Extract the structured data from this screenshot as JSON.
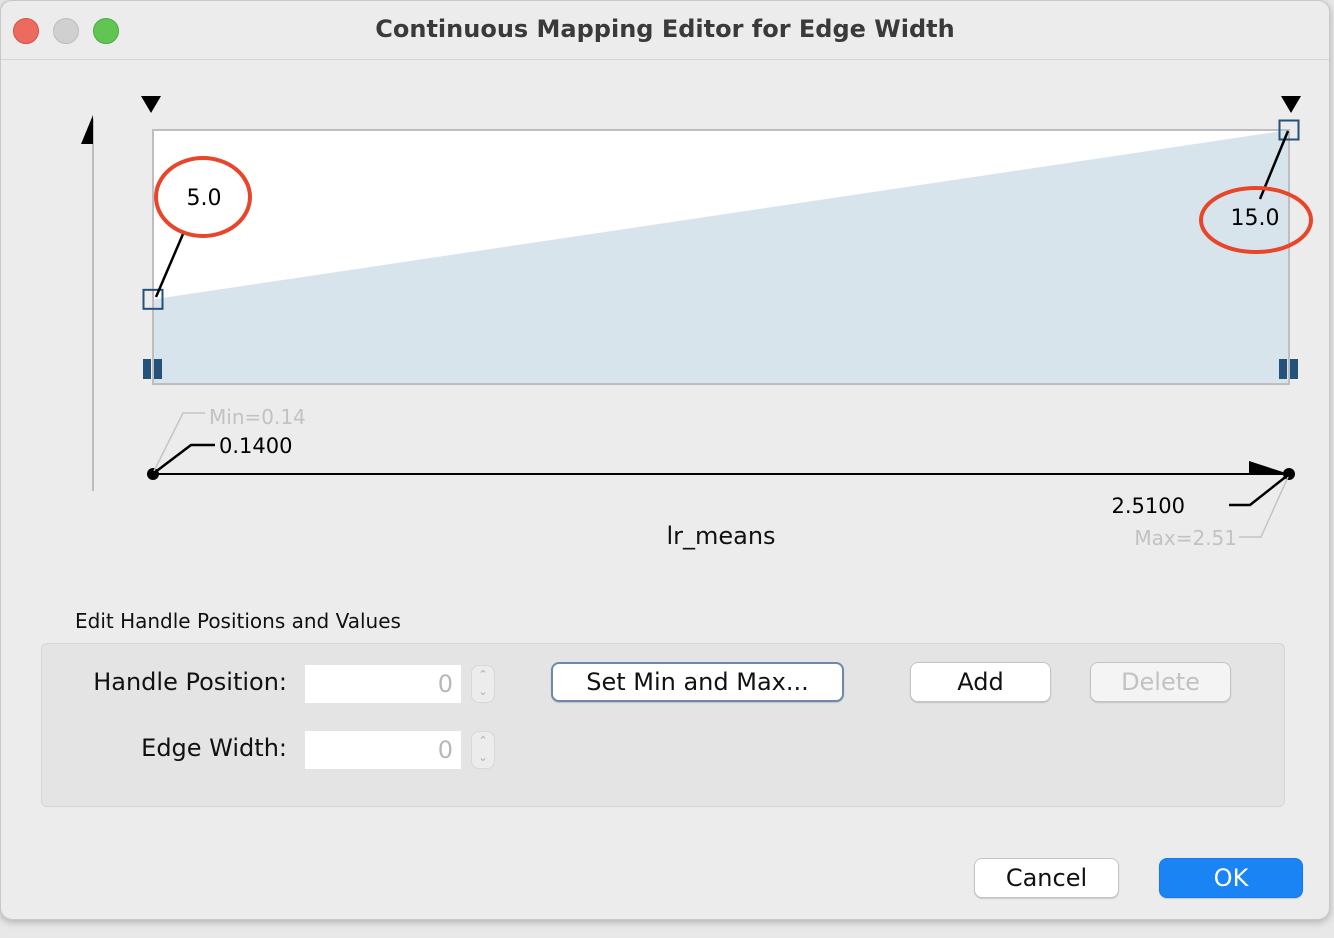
{
  "window": {
    "title": "Continuous Mapping Editor for Edge Width"
  },
  "chart_data": {
    "type": "line",
    "xlabel": "lr_means",
    "xlim": [
      0.14,
      2.51
    ],
    "ylim": [
      0,
      15
    ],
    "points": [
      {
        "x": 0.14,
        "y": 5.0,
        "label": "5.0"
      },
      {
        "x": 2.51,
        "y": 15.0,
        "label": "15.0"
      }
    ],
    "min_label": "Min=0.14",
    "max_label": "Max=2.51",
    "min_value_label": "0.1400",
    "max_value_label": "2.5100",
    "fill_color": "#d8e4ec",
    "handle_color": "#24527a",
    "annotation_color": "#e8452a"
  },
  "editor": {
    "section_title": "Edit Handle Positions and Values",
    "handle_position_label": "Handle Position:",
    "handle_position_value": "0",
    "edge_width_label": "Edge Width:",
    "edge_width_value": "0",
    "set_min_max_label": "Set Min and Max...",
    "add_label": "Add",
    "delete_label": "Delete"
  },
  "footer": {
    "cancel_label": "Cancel",
    "ok_label": "OK"
  }
}
